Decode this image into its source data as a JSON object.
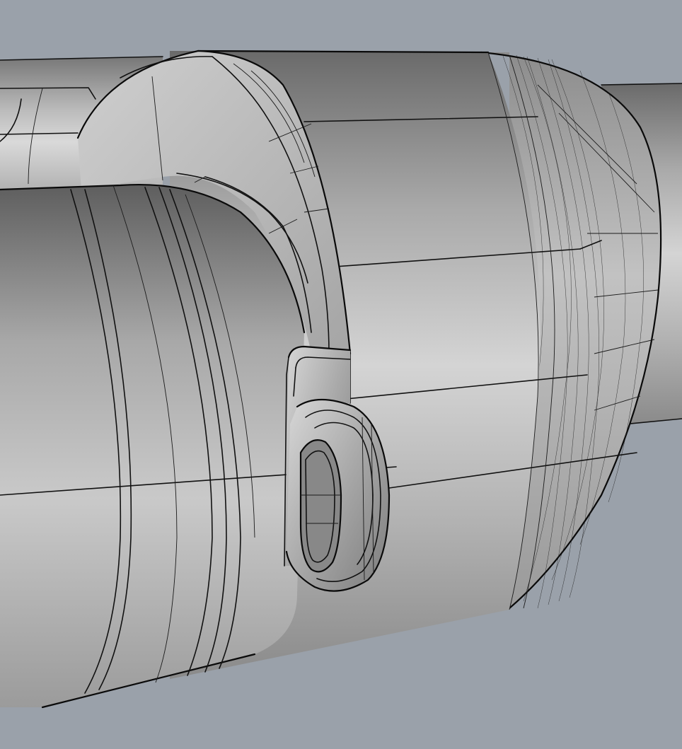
{
  "scene": {
    "description_visible_text": "",
    "colors": {
      "background": "#9aa1aa",
      "surface_light": "#d3d3d3",
      "surface_mid": "#b4b4b4",
      "surface_dark": "#6e6e6e",
      "edge": "#111111"
    },
    "parts": [
      {
        "name": "rear-shaft"
      },
      {
        "name": "main-housing"
      },
      {
        "name": "front-flange-ring"
      },
      {
        "name": "tapered-nose-cap"
      },
      {
        "name": "outlet-shaft"
      },
      {
        "name": "foreground-cylinder"
      },
      {
        "name": "mounting-lug"
      },
      {
        "name": "lug-eye-loop"
      }
    ]
  }
}
